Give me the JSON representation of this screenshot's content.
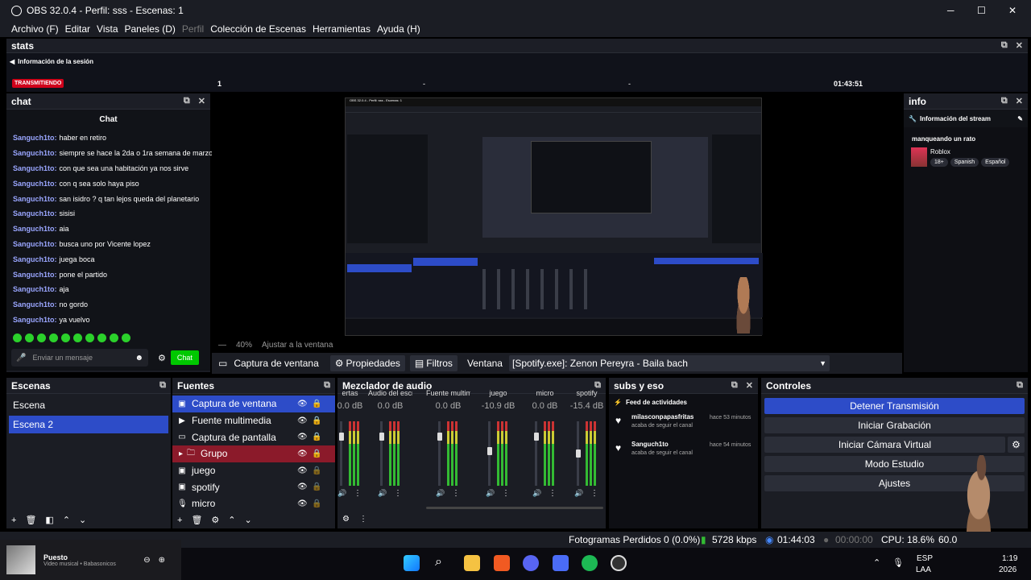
{
  "window": {
    "title": "OBS 32.0.4 - Perfil: sss - Escenas: 1",
    "min": "─",
    "max": "☐",
    "close": "✕"
  },
  "menu": [
    "Archivo (F)",
    "Editar",
    "Vista",
    "Paneles (D)",
    "Perfil",
    "Colección de Escenas",
    "Herramientas",
    "Ayuda (H)"
  ],
  "stats": {
    "title": "stats",
    "session": "Información de la sesión",
    "badge": "TRANSMITIENDO",
    "c1": "1",
    "c2": "-",
    "c3": "-",
    "time": "01:43:51"
  },
  "chat": {
    "dock": "chat",
    "title": "Chat",
    "placeholder": "Enviar un mensaje",
    "send": "Chat",
    "lines": [
      {
        "u": "Sanguch1to:",
        "m": "haber en retiro"
      },
      {
        "u": "Sanguch1to:",
        "m": "siempre se hace la 2da o 1ra semana de marzo"
      },
      {
        "u": "Sanguch1to:",
        "m": "con que sea una habitación ya nos sirve"
      },
      {
        "u": "Sanguch1to:",
        "m": "con q sea solo haya piso"
      },
      {
        "u": "Sanguch1to:",
        "m": "san isidro ? q tan lejos queda del planetario"
      },
      {
        "u": "Sanguch1to:",
        "m": "sisisi"
      },
      {
        "u": "Sanguch1to:",
        "m": "aia"
      },
      {
        "u": "Sanguch1to:",
        "m": "busca uno por Vicente lopez"
      },
      {
        "u": "Sanguch1to:",
        "m": "juega boca"
      },
      {
        "u": "Sanguch1to:",
        "m": "pone el partido"
      },
      {
        "u": "Sanguch1to:",
        "m": "aja"
      },
      {
        "u": "Sanguch1to:",
        "m": "no gordo"
      },
      {
        "u": "Sanguch1to:",
        "m": "ya vuelvo"
      }
    ]
  },
  "info": {
    "dock": "info",
    "header": "Información del stream",
    "title": "manqueando un rato",
    "game": "Roblox",
    "tags": [
      "18+",
      "Spanish",
      "Español"
    ]
  },
  "preview": {
    "zoom": "40%",
    "fit": "Ajustar a la ventana"
  },
  "toolbar": {
    "source": "Captura de ventana",
    "props": "Propiedades",
    "filters": "Filtros",
    "win_label": "Ventana",
    "win_value": "[Spotify.exe]: Zenon Pereyra - Baila bach"
  },
  "scenes": {
    "title": "Escenas",
    "items": [
      "Escena",
      "Escena 2"
    ]
  },
  "sources": {
    "title": "Fuentes",
    "items": [
      {
        "name": "Captura de ventana",
        "icon": "▣"
      },
      {
        "name": "Fuente multimedia",
        "icon": "▶"
      },
      {
        "name": "Captura de pantalla",
        "icon": "▭"
      },
      {
        "name": "Grupo",
        "icon": "🗀"
      },
      {
        "name": "juego",
        "icon": "▣"
      },
      {
        "name": "spotify",
        "icon": "▣"
      },
      {
        "name": "micro",
        "icon": "🎙"
      }
    ]
  },
  "mixer": {
    "title": "Mezclador de audio",
    "channels": [
      {
        "name": "ertas",
        "db": "0.0 dB"
      },
      {
        "name": "Audio del escrito",
        "db": "0.0 dB"
      },
      {
        "name": "Fuente multimec",
        "db": "0.0 dB"
      },
      {
        "name": "juego",
        "db": "-10.9 dB"
      },
      {
        "name": "micro",
        "db": "0.0 dB"
      },
      {
        "name": "spotify",
        "db": "-15.4 dB"
      }
    ]
  },
  "subs": {
    "title": "subs y eso",
    "feed": "Feed de actividades",
    "events": [
      {
        "user": "milasconpapasfritas",
        "action": "acaba de seguir el canal",
        "time": "hace 53 minutos"
      },
      {
        "user": "Sanguch1to",
        "action": "acaba de seguir el canal",
        "time": "hace 54 minutos"
      }
    ]
  },
  "controls": {
    "title": "Controles",
    "buttons": [
      "Detener Transmisión",
      "Iniciar Grabación",
      "Iniciar Cámara Virtual",
      "Modo Estudio",
      "Ajustes"
    ]
  },
  "status": {
    "dropped": "Fotogramas Perdidos 0 (0.0%)",
    "kbps": "5728 kbps",
    "live": "01:44:03",
    "rec": "00:00:00",
    "cpu": "CPU: 18.6%",
    "fps": "60.0"
  },
  "media": {
    "title": "Puesto",
    "sub": "Video musical • Babasonicos"
  },
  "tray": {
    "lang": "ESP",
    "kb": "LAA",
    "time": "1:19",
    "date": "2026"
  },
  "colors": {
    "accent": "#2d4cc8",
    "live": "#d0021b",
    "bg": "#1b1d24"
  }
}
